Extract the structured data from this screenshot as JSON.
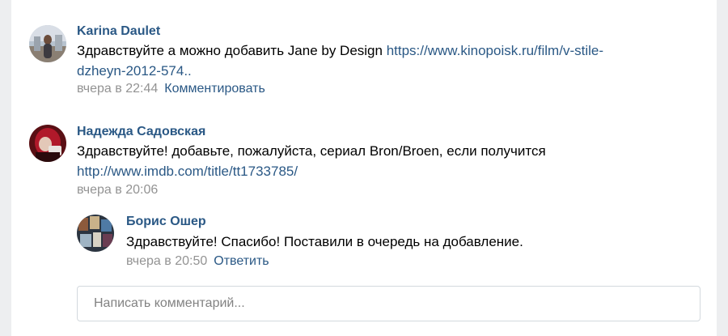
{
  "comments": [
    {
      "author": "Karina Daulet",
      "text": "Здравствуйте а можно добавить Jane by Design ",
      "link_line1": "https://www.kinopoisk.ru/film/v-stile-",
      "link_line2": "dzheyn-2012-574..",
      "time": "вчера в 22:44",
      "action": "Комментировать"
    },
    {
      "author": "Надежда Садовская",
      "text": "Здравствуйте! добавьте, пожалуйста, сериал Bron/Broen, если получится",
      "link": "http://www.imdb.com/title/tt1733785/",
      "time": "вчера в 20:06"
    },
    {
      "author": "Борис Ошер",
      "text": "Здравствуйте! Спасибо! Поставили в очередь на добавление.",
      "time": "вчера в 20:50",
      "action": "Ответить"
    }
  ],
  "comment_input": {
    "placeholder": "Написать комментарий..."
  },
  "colors": {
    "link": "#2a5885",
    "meta": "#939393",
    "background": "#edeef0",
    "icon": "#c5d0db"
  },
  "icons": [
    "more-dots-icon",
    "heart-icon"
  ]
}
